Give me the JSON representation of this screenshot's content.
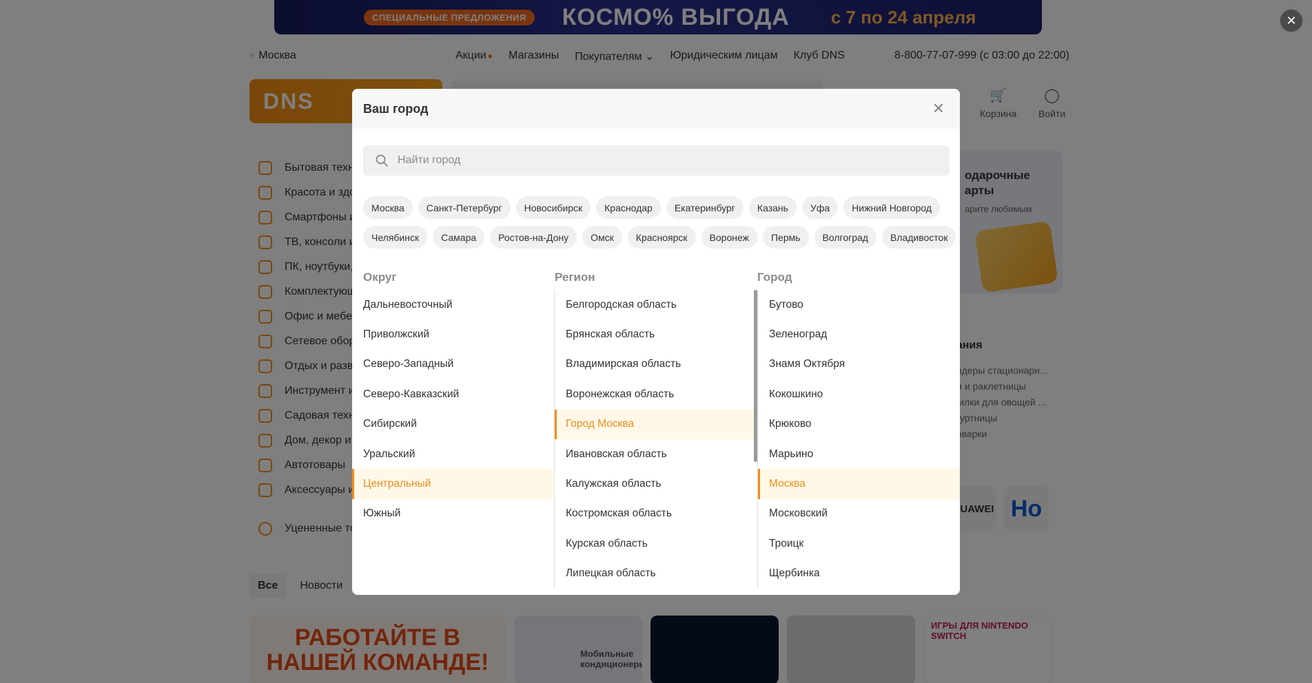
{
  "banner": {
    "pill": "СПЕЦИАЛЬНЫЕ ПРЕДЛОЖЕНИЯ",
    "title": "КОСМО% ВЫГОДА",
    "dates": "с 7 по 24 апреля"
  },
  "topbar": {
    "city": "Москва",
    "nav": [
      "Акции",
      "Магазины",
      "Покупателям ⌄",
      "Юридическим лицам",
      "Клуб DNS"
    ],
    "phone": "8-800-77-07-999 (с 03:00 до 22:00)"
  },
  "logo": "DNS",
  "header_icons": [
    {
      "icon": "cart-icon",
      "label": "Корзина"
    },
    {
      "icon": "user-icon",
      "label": "Войти"
    }
  ],
  "catalog": [
    "Бытовая техника",
    "Красота и здоровье",
    "Смартфоны и гаджеты",
    "ТВ, консоли и аудио",
    "ПК, ноутбуки, периферия",
    "Комплектующие для ПК",
    "Офис и мебель",
    "Сетевое оборудование",
    "Отдых и развлечения",
    "Инструмент и стройка",
    "Садовая техника",
    "Дом, декор и кухня",
    "Автотовары",
    "Аксессуары и услуги"
  ],
  "catalog_extra": "Уцененные товары",
  "bg_tabs": [
    "Все",
    "Новости"
  ],
  "promo_right": {
    "title": "одарочные\nарты",
    "subtitle": "арите любимым"
  },
  "right_list": {
    "heading": "тания",
    "items": [
      "ендеры стационарн...",
      "ли и раклетницы",
      "шилки для овощей ...",
      "огуртницы",
      "роварки"
    ]
  },
  "brands": [
    "HUAWEI",
    "Hо"
  ],
  "tiles": {
    "job": "РАБОТАЙТЕ В НАШЕЙ КОМАНДЕ!",
    "conditioners": "Мобильные кондиционеры",
    "switch": "ИГРЫ ДЛЯ NINTENDO SWITCH"
  },
  "modal": {
    "title": "Ваш город",
    "search_placeholder": "Найти город",
    "popular_row1": [
      "Москва",
      "Санкт-Петербург",
      "Новосибирск",
      "Краснодар",
      "Екатеринбург",
      "Казань",
      "Уфа",
      "Нижний Новгород"
    ],
    "popular_row2": [
      "Челябинск",
      "Самара",
      "Ростов-на-Дону",
      "Омск",
      "Красноярск",
      "Воронеж",
      "Пермь",
      "Волгоград",
      "Владивосток"
    ],
    "district_title": "Округ",
    "region_title": "Регион",
    "city_title": "Город",
    "districts": [
      "Дальневосточный",
      "Приволжский",
      "Северо-Западный",
      "Северо-Кавказский",
      "Сибирский",
      "Уральский",
      "Центральный",
      "Южный"
    ],
    "selected_district": "Центральный",
    "regions": [
      "Белгородская область",
      "Брянская область",
      "Владимирская область",
      "Воронежская область",
      "Город Москва",
      "Ивановская область",
      "Калужская область",
      "Костромская область",
      "Курская область",
      "Липецкая область"
    ],
    "selected_region": "Город Москва",
    "cities": [
      "Бутово",
      "Зеленоград",
      "Знамя Октября",
      "Кокошкино",
      "Крюково",
      "Марьино",
      "Москва",
      "Московский",
      "Троицк",
      "Щербинка"
    ],
    "selected_city": "Москва"
  },
  "colors": {
    "accent": "#f28c1b",
    "selected_bg": "#fff8e8"
  }
}
